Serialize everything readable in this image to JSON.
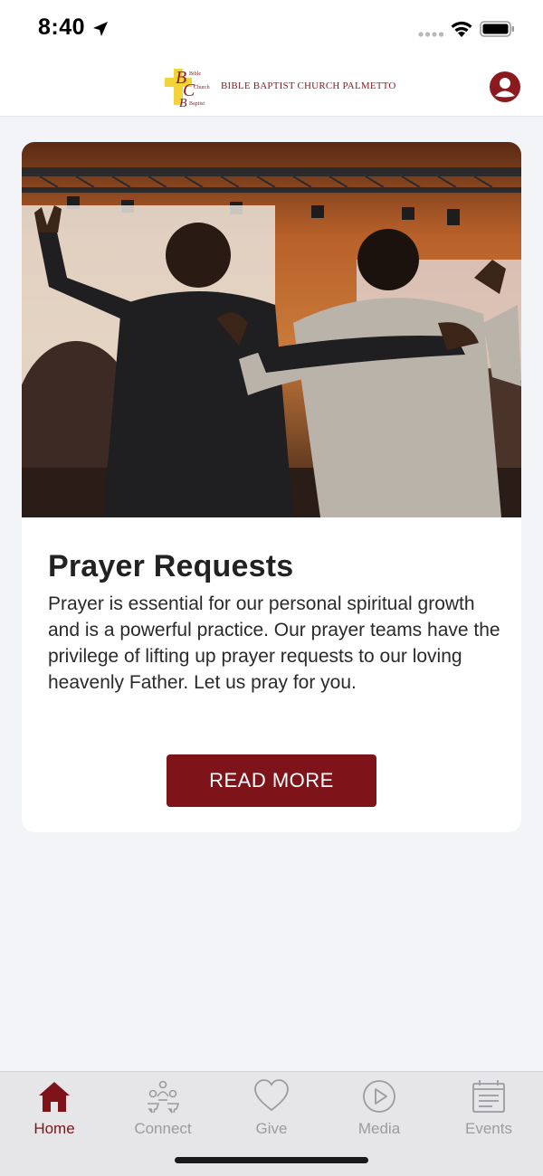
{
  "status_bar": {
    "time": "8:40"
  },
  "header": {
    "logo_text": "BIBLE BAPTIST CHURCH PALMETTO",
    "logo_mark_letters": [
      "Bible",
      "Church",
      "Baptist"
    ]
  },
  "card": {
    "image_alt": "Two men with arms around each other raising hands in worship",
    "title": "Prayer Requests",
    "body": "Prayer is essential for our personal spiritual growth and is a powerful practice. Our prayer teams have the privilege of lifting up prayer requests to our loving heavenly Father. Let us pray for you.",
    "button_label": "READ MORE"
  },
  "tabs": [
    {
      "label": "Home",
      "icon": "home-icon",
      "active": true
    },
    {
      "label": "Connect",
      "icon": "people-icon",
      "active": false
    },
    {
      "label": "Give",
      "icon": "heart-icon",
      "active": false
    },
    {
      "label": "Media",
      "icon": "play-icon",
      "active": false
    },
    {
      "label": "Events",
      "icon": "calendar-icon",
      "active": false
    }
  ],
  "colors": {
    "brand": "#7e1419",
    "background": "#f3f4f8",
    "tab_inactive": "#9b9ba0"
  }
}
